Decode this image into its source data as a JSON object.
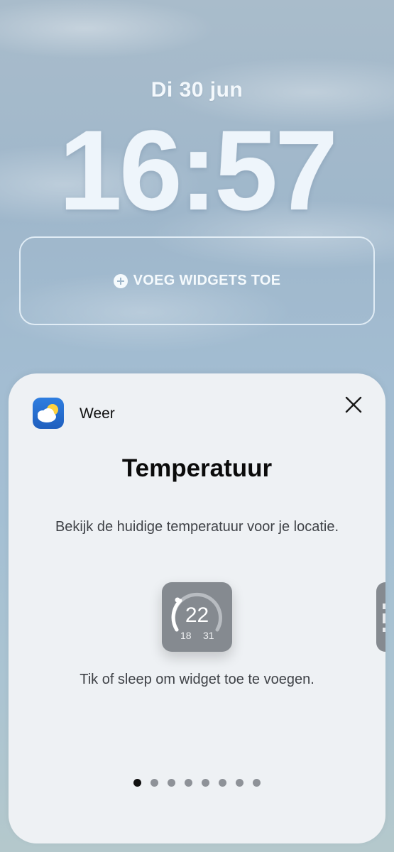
{
  "lockscreen": {
    "date": "Di 30 jun",
    "time": "16:57",
    "add_widgets_label": "VOEG WIDGETS TOE"
  },
  "sheet": {
    "app_name": "Weer",
    "title": "Temperatuur",
    "description": "Bekijk de huidige temperatuur voor je locatie.",
    "hint": "Tik of sleep om widget toe te voegen.",
    "widget": {
      "current_temp": "22",
      "low_temp": "18",
      "high_temp": "31"
    },
    "page_count": 8,
    "active_page": 1
  },
  "colors": {
    "sheet_bg": "#eef1f4",
    "widget_bg": "#858a90",
    "app_icon_blue": "#2f7ee0"
  },
  "icons": {
    "plus": "plus-circle-icon",
    "close": "close-icon",
    "app": "weather-app-icon"
  }
}
